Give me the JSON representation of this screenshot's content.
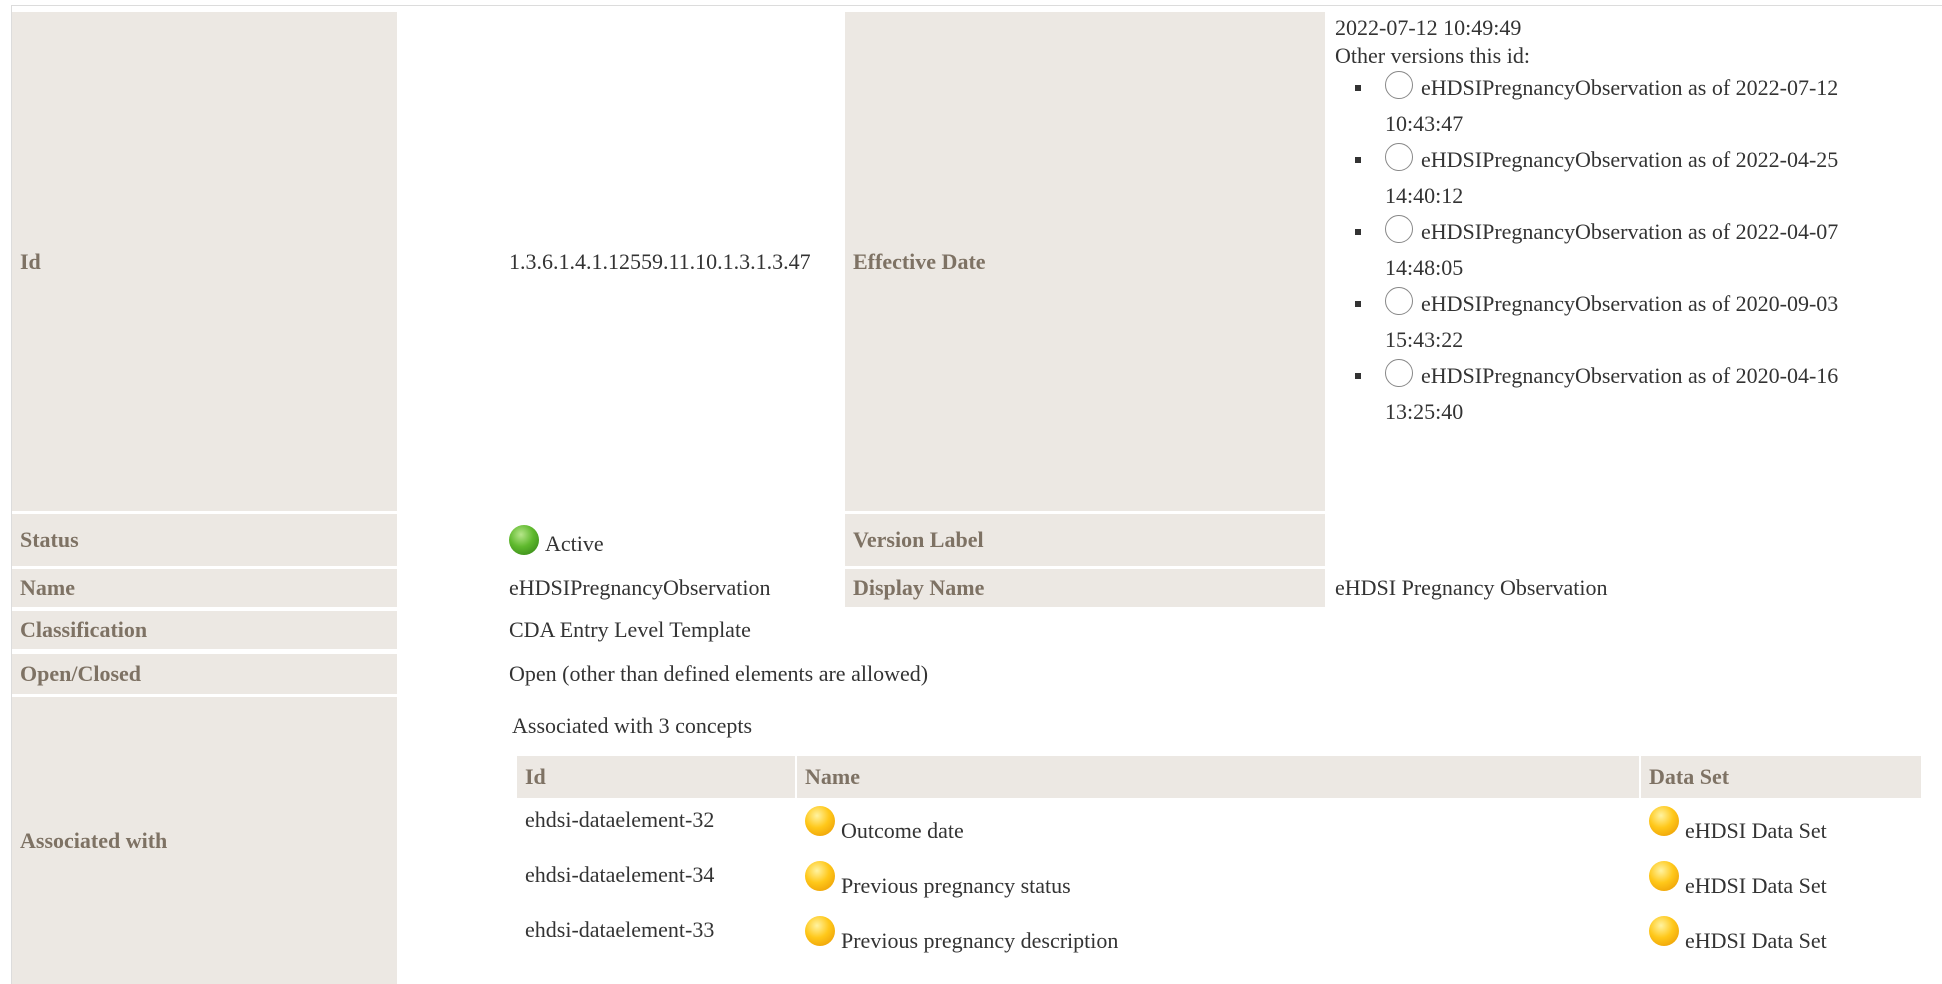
{
  "labels": {
    "id": "Id",
    "effective_date": "Effective Date",
    "status": "Status",
    "version_label": "Version Label",
    "name": "Name",
    "display_name": "Display Name",
    "classification": "Classification",
    "open_closed": "Open/Closed",
    "associated_with": "Associated with"
  },
  "values": {
    "id": "1.3.6.1.4.1.12559.11.10.1.3.1.3.47",
    "effective_date": "2022-07-12 10:49:49",
    "other_versions_label": "Other versions this id:",
    "status": "Active",
    "version_label": "",
    "name": "eHDSIPregnancyObservation",
    "display_name": "eHDSI Pregnancy Observation",
    "classification": "CDA Entry Level Template",
    "open_closed": "Open (other than defined elements are allowed)"
  },
  "other_versions": [
    {
      "line1": "eHDSIPregnancyObservation as of 2022-07-12",
      "line2": "10:43:47"
    },
    {
      "line1": "eHDSIPregnancyObservation as of 2022-04-25",
      "line2": "14:40:12"
    },
    {
      "line1": "eHDSIPregnancyObservation as of 2022-04-07",
      "line2": "14:48:05"
    },
    {
      "line1": "eHDSIPregnancyObservation as of 2020-09-03",
      "line2": "15:43:22"
    },
    {
      "line1": "eHDSIPregnancyObservation as of 2020-04-16",
      "line2": "13:25:40"
    }
  ],
  "associated": {
    "summary": "Associated with 3 concepts",
    "columns": [
      "Id",
      "Name",
      "Data Set"
    ],
    "rows": [
      {
        "id": "ehdsi-dataelement-32",
        "name": "Outcome date",
        "dataset": "eHDSI Data Set"
      },
      {
        "id": "ehdsi-dataelement-34",
        "name": "Previous pregnancy status",
        "dataset": "eHDSI Data Set"
      },
      {
        "id": "ehdsi-dataelement-33",
        "name": "Previous pregnancy description",
        "dataset": "eHDSI Data Set"
      }
    ]
  },
  "colors": {
    "label_bg": "#ece8e3",
    "label_text": "#7e7264",
    "status_active": "#5fb92d",
    "concept_ball": "#ffc81a"
  },
  "icons": {
    "status": "green-ball-icon",
    "version_selector": "radio-circle-icon",
    "concept": "yellow-ball-icon"
  }
}
